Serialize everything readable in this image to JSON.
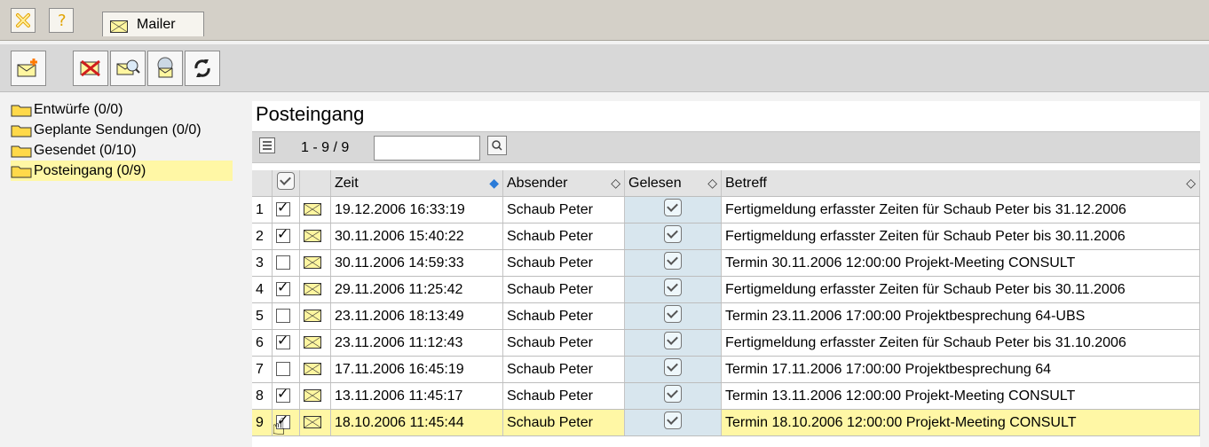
{
  "top": {
    "tab_label": "Mailer"
  },
  "icons": {
    "close": "close-icon",
    "help": "help-icon",
    "mail": "mail-icon",
    "new": "new-mail-icon",
    "delete": "delete-mail-icon",
    "search": "search-mail-icon",
    "web": "web-mail-icon",
    "refresh": "refresh-icon"
  },
  "folders": [
    {
      "label": "Entwürfe (0/0)"
    },
    {
      "label": "Geplante Sendungen (0/0)"
    },
    {
      "label": "Gesendet (0/10)"
    },
    {
      "label": "Posteingang (0/9)"
    }
  ],
  "main": {
    "title": "Posteingang",
    "pager": "1 - 9 / 9",
    "search_placeholder": "",
    "headers": {
      "zeit": "Zeit",
      "absender": "Absender",
      "gelesen": "Gelesen",
      "betreff": "Betreff"
    },
    "rows": [
      {
        "index": "1",
        "checked": true,
        "time": "19.12.2006 16:33:19",
        "sender": "Schaub Peter",
        "subject": "Fertigmeldung erfasster Zeiten für Schaub Peter bis 31.12.2006"
      },
      {
        "index": "2",
        "checked": true,
        "time": "30.11.2006 15:40:22",
        "sender": "Schaub Peter",
        "subject": "Fertigmeldung erfasster Zeiten für Schaub Peter bis 30.11.2006"
      },
      {
        "index": "3",
        "checked": false,
        "time": "30.11.2006 14:59:33",
        "sender": "Schaub Peter",
        "subject": "Termin 30.11.2006 12:00:00 Projekt-Meeting CONSULT"
      },
      {
        "index": "4",
        "checked": true,
        "time": "29.11.2006 11:25:42",
        "sender": "Schaub Peter",
        "subject": "Fertigmeldung erfasster Zeiten für Schaub Peter bis 30.11.2006"
      },
      {
        "index": "5",
        "checked": false,
        "time": "23.11.2006 18:13:49",
        "sender": "Schaub Peter",
        "subject": "Termin 23.11.2006 17:00:00 Projektbesprechung 64-UBS"
      },
      {
        "index": "6",
        "checked": true,
        "time": "23.11.2006 11:12:43",
        "sender": "Schaub Peter",
        "subject": "Fertigmeldung erfasster Zeiten für Schaub Peter bis 31.10.2006"
      },
      {
        "index": "7",
        "checked": false,
        "time": "17.11.2006 16:45:19",
        "sender": "Schaub Peter",
        "subject": "Termin 17.11.2006 17:00:00 Projektbesprechung 64"
      },
      {
        "index": "8",
        "checked": true,
        "time": "13.11.2006 11:45:17",
        "sender": "Schaub Peter",
        "subject": "Termin 13.11.2006 12:00:00 Projekt-Meeting CONSULT"
      },
      {
        "index": "9",
        "checked": true,
        "time": "18.10.2006 11:45:44",
        "sender": "Schaub Peter",
        "subject": "Termin 18.10.2006 12:00:00 Projekt-Meeting CONSULT"
      }
    ]
  }
}
